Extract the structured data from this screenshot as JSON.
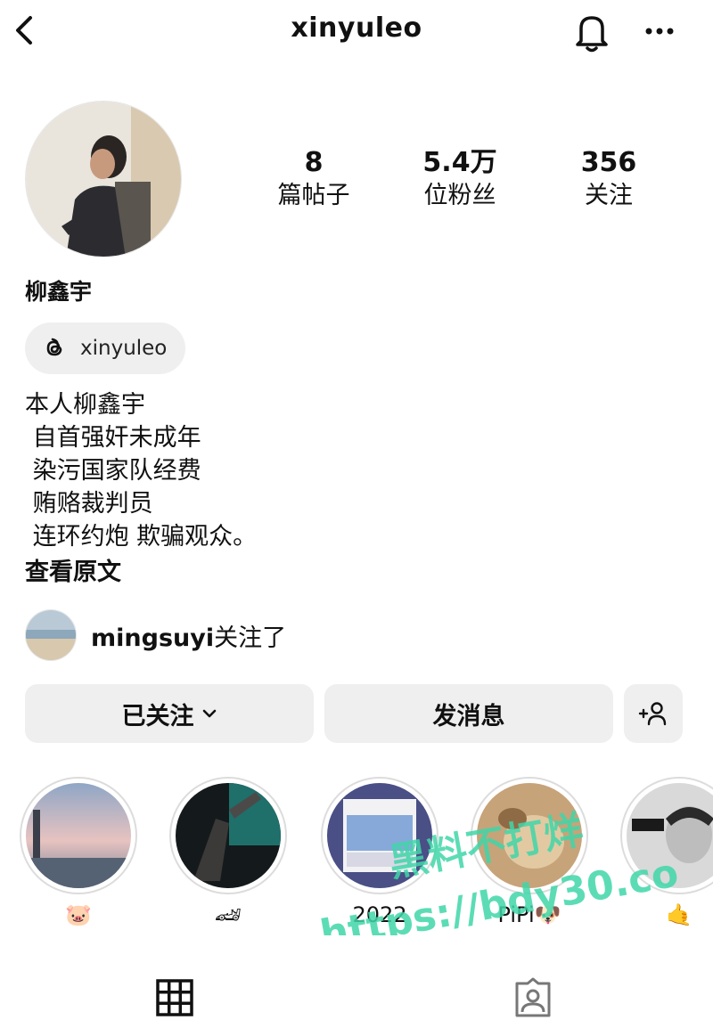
{
  "header": {
    "username": "xinyuleo",
    "icons": [
      "back-icon",
      "bell-icon",
      "more-icon"
    ]
  },
  "stats": {
    "posts": {
      "value": "8",
      "label": "篇帖子"
    },
    "followers": {
      "value": "5.4万",
      "label": "位粉丝"
    },
    "following": {
      "value": "356",
      "label": "关注"
    }
  },
  "profile": {
    "display_name": "柳鑫宇",
    "threads_handle": "xinyuleo",
    "bio_lines": [
      "本人柳鑫宇",
      " 自首强奸未成年",
      " 染污国家队经费",
      " 贿赂裁判员",
      " 连环约炮 欺骗观众。"
    ],
    "see_original": "查看原文"
  },
  "followed_by": {
    "user": "mingsuyi",
    "suffix": "关注了"
  },
  "buttons": {
    "following_label": "已关注",
    "message_label": "发消息"
  },
  "highlights": [
    {
      "caption": "🐷"
    },
    {
      "caption": "🏎"
    },
    {
      "caption": "2022"
    },
    {
      "caption": "PiPi🐶"
    },
    {
      "caption": "🤙"
    }
  ],
  "watermark": {
    "line1": "黑料不打烊",
    "line2": "https://bdy30.co"
  },
  "colors": {
    "button_bg": "#efefef",
    "watermark": "#3fd6a8",
    "text": "#111111"
  }
}
